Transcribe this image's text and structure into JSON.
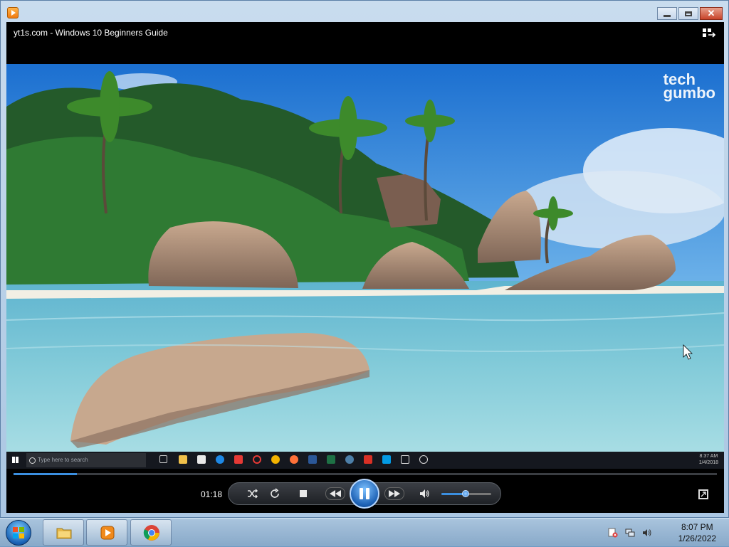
{
  "window": {
    "video_title": "yt1s.com - Windows 10 Beginners Guide",
    "close_glyph": "✕"
  },
  "video": {
    "watermark_line1": "tech",
    "watermark_line2": "gumbo",
    "inner_taskbar": {
      "search_placeholder": "Type here to search",
      "tray_time": "8:37 AM",
      "tray_date": "1/4/2018"
    }
  },
  "controls": {
    "elapsed_time": "01:18",
    "progress_fraction": 0.09,
    "volume_fraction": 0.48,
    "shuffle_icon": "shuffle-icon",
    "repeat_icon": "repeat-icon",
    "stop_icon": "stop-icon",
    "previous_icon": "previous-icon",
    "pause_icon": "pause-icon",
    "next_icon": "next-icon",
    "volume_icon": "speaker-icon"
  },
  "taskbar": {
    "pinned": [
      "file-explorer",
      "windows-media-player",
      "google-chrome"
    ],
    "time": "8:07 PM",
    "date": "1/26/2022"
  },
  "colors": {
    "accent": "#3b8fe0",
    "taskbar": "#a9c4dd",
    "player_bg": "#000000"
  }
}
